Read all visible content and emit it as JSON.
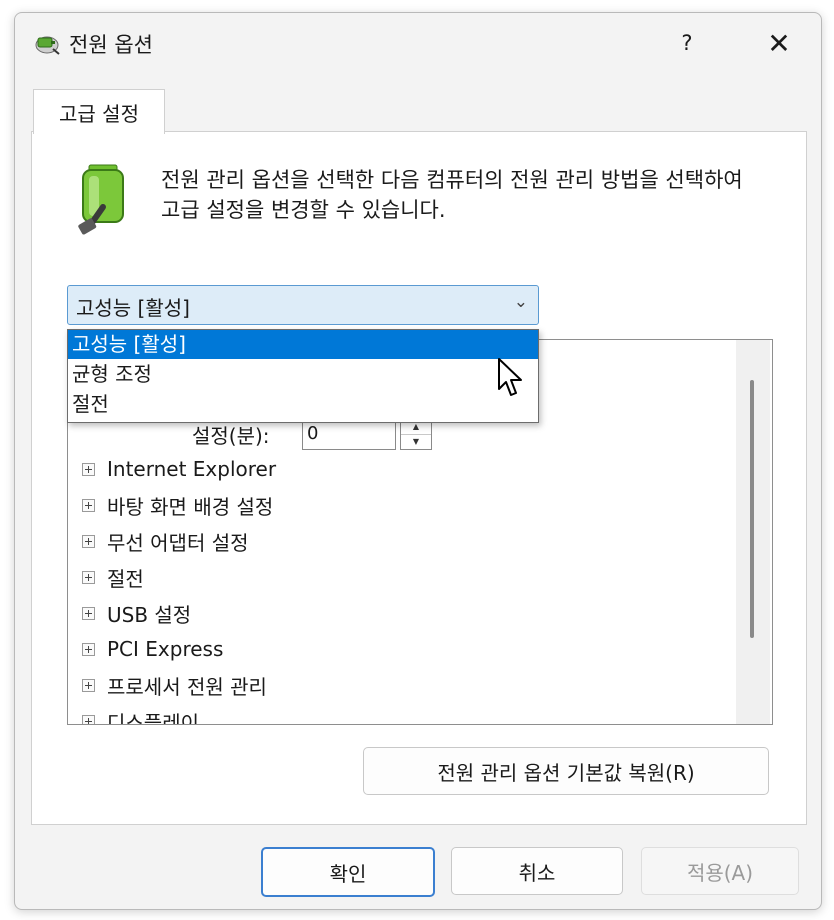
{
  "window": {
    "title": "전원 옵션",
    "help_label": "?",
    "close_label": "✕",
    "title_icon": "power-options-icon"
  },
  "tabs": [
    {
      "label": "고급 설정"
    }
  ],
  "description": "전원 관리 옵션을 선택한 다음 컴퓨터의 전원 관리 방법을 선택하여 고급 설정을 변경할 수 있습니다.",
  "battery_icon": "battery-plug-icon",
  "plan_select": {
    "value": "고성능 [활성]",
    "options": [
      {
        "label": "고성능 [활성]",
        "selected": true
      },
      {
        "label": "균형 조정",
        "selected": false
      },
      {
        "label": "절전",
        "selected": false
      }
    ]
  },
  "settings_tree": {
    "partial_setting": {
      "label": "설정(분):",
      "value": "0"
    },
    "items": [
      {
        "label": "Internet Explorer"
      },
      {
        "label": "바탕 화면 배경 설정"
      },
      {
        "label": "무선 어댑터 설정"
      },
      {
        "label": "절전"
      },
      {
        "label": "USB 설정"
      },
      {
        "label": "PCI Express"
      },
      {
        "label": "프로세서 전원 관리"
      },
      {
        "label": "디스플레이"
      }
    ]
  },
  "restore_button": "전원 관리 옵션 기본값 복원(R)",
  "footer": {
    "ok": "확인",
    "cancel": "취소",
    "apply": "적용(A)"
  },
  "colors": {
    "accent": "#0078d7",
    "combo_bg": "#ddecf8",
    "combo_border": "#5a9ad2",
    "ok_border": "#3b7fd0"
  }
}
